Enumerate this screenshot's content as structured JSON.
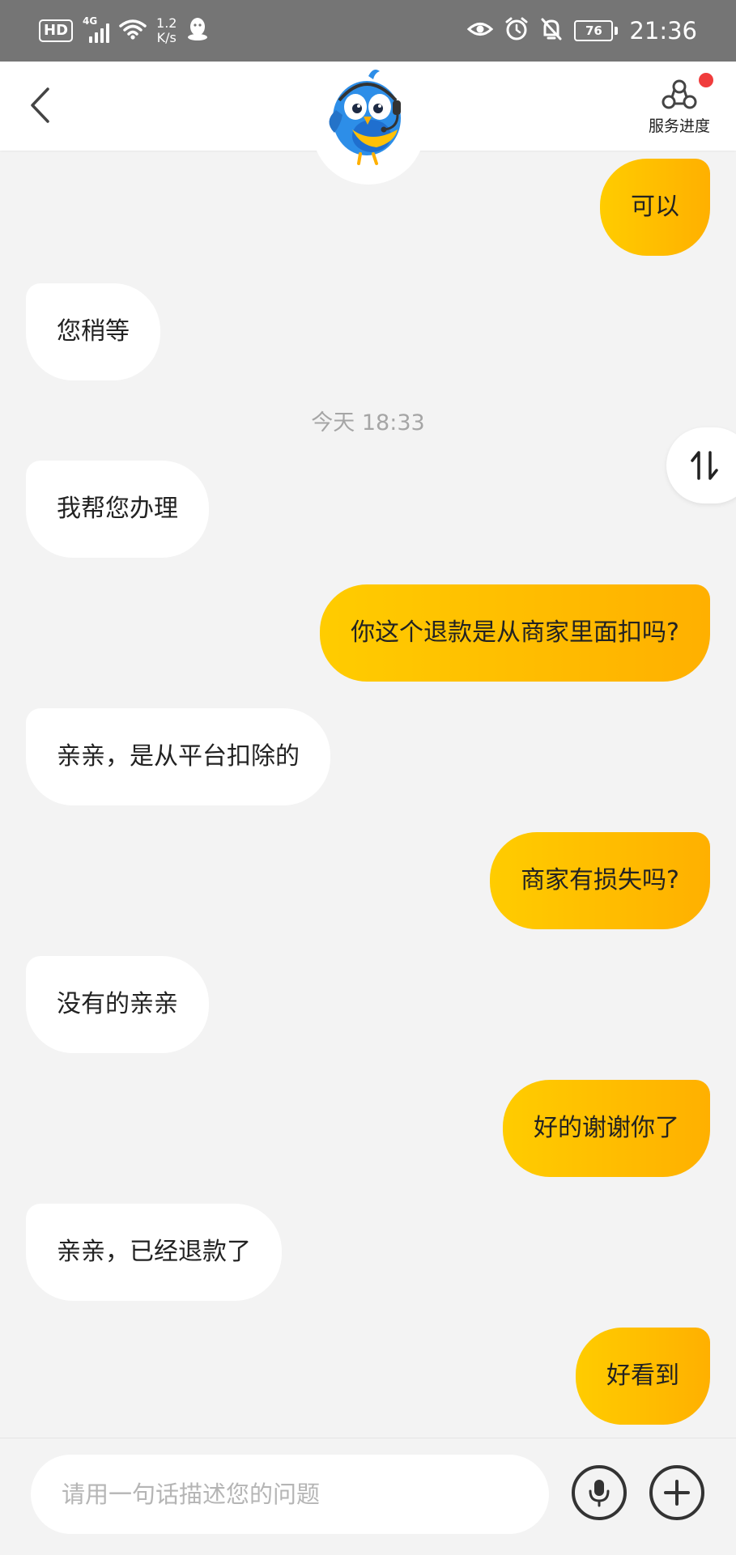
{
  "status_bar": {
    "hd": "HD",
    "network": "4G",
    "speed_value": "1.2",
    "speed_unit": "K/s",
    "battery": "76",
    "time": "21:36",
    "icons": [
      "wifi-icon",
      "qq-icon",
      "eye-icon",
      "alarm-icon",
      "mute-icon"
    ]
  },
  "header": {
    "service_label": "服务进度",
    "has_notification": true
  },
  "messages": [
    {
      "side": "right",
      "text": "可以"
    },
    {
      "side": "left",
      "text": "您稍等"
    },
    {
      "side": "left",
      "text": "我帮您办理"
    },
    {
      "side": "right",
      "text": "你这个退款是从商家里面扣吗?"
    },
    {
      "side": "left",
      "text": "亲亲，是从平台扣除的"
    },
    {
      "side": "right",
      "text": "商家有损失吗?"
    },
    {
      "side": "left",
      "text": "没有的亲亲"
    },
    {
      "side": "right",
      "text": "好的谢谢你了"
    },
    {
      "side": "left",
      "text": "亲亲，已经退款了"
    },
    {
      "side": "right",
      "text": "好看到"
    }
  ],
  "timestamp": "今天 18:33",
  "input": {
    "value": "",
    "placeholder": "请用一句话描述您的问题"
  },
  "colors": {
    "accent_start": "#ffcc00",
    "accent_end": "#ffb000",
    "notification": "#f03c3c",
    "background": "#f3f3f3"
  }
}
